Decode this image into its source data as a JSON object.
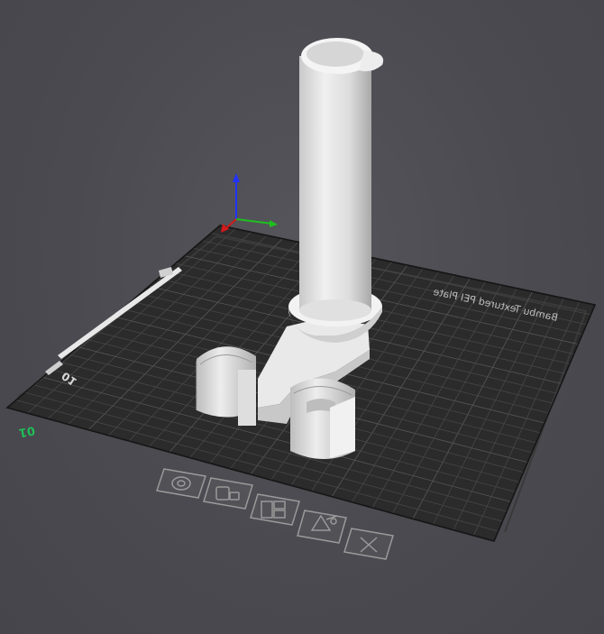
{
  "viewport": {
    "plate_name": "Bambu Textured PEI Plate",
    "plate_number": "01",
    "origin_label": "01",
    "plate_tools": [
      {
        "id": "tool-orient",
        "icon": "target-icon"
      },
      {
        "id": "tool-arrange",
        "icon": "auto-arrange-icon"
      },
      {
        "id": "tool-layout",
        "icon": "plate-layout-icon"
      },
      {
        "id": "tool-settings",
        "icon": "plate-settings-icon"
      },
      {
        "id": "tool-remove",
        "icon": "close-icon"
      }
    ]
  },
  "colors": {
    "background": "#4a4a50",
    "plate": "#2b2b2b",
    "grid": "#3f3f3f",
    "model": "#e6e6e6",
    "axis_x": "#d11a1a",
    "axis_y": "#1fbf1f",
    "axis_z": "#2233ff"
  }
}
